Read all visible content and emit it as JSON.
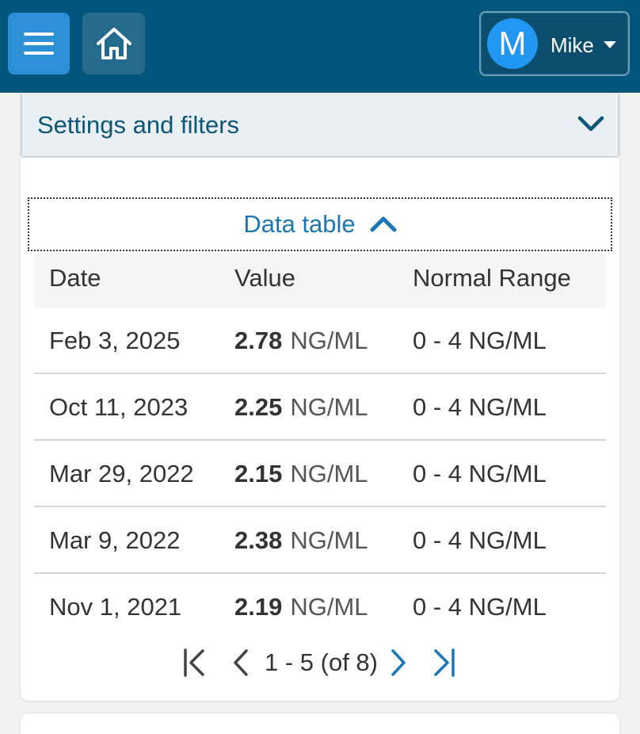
{
  "header": {
    "menu_icon": "hamburger-menu-icon",
    "home_icon": "home-icon",
    "user": {
      "initial": "M",
      "name": "Mike",
      "caret_icon": "caret-down-icon"
    },
    "colors": {
      "bar": "#02557b",
      "menu_button": "#2d8fd5",
      "avatar": "#2196f3"
    }
  },
  "filters": {
    "title": "Settings and filters",
    "icon": "chevron-down-icon"
  },
  "data_table": {
    "toggle_label": "Data table",
    "toggle_icon": "chevron-up-icon",
    "columns": [
      "Date",
      "Value",
      "Normal Range"
    ],
    "rows": [
      {
        "date": "Feb 3, 2025",
        "value": "2.78",
        "unit": "NG/ML",
        "range": "0 - 4 NG/ML"
      },
      {
        "date": "Oct 11, 2023",
        "value": "2.25",
        "unit": "NG/ML",
        "range": "0 - 4 NG/ML"
      },
      {
        "date": "Mar 29, 2022",
        "value": "2.15",
        "unit": "NG/ML",
        "range": "0 - 4 NG/ML"
      },
      {
        "date": "Mar 9, 2022",
        "value": "2.38",
        "unit": "NG/ML",
        "range": "0 - 4 NG/ML"
      },
      {
        "date": "Nov 1, 2021",
        "value": "2.19",
        "unit": "NG/ML",
        "range": "0 - 4 NG/ML"
      }
    ]
  },
  "pagination": {
    "label": "1 - 5 (of 8)",
    "first_icon": "first-page-icon",
    "prev_icon": "previous-page-icon",
    "next_icon": "next-page-icon",
    "last_icon": "last-page-icon"
  }
}
